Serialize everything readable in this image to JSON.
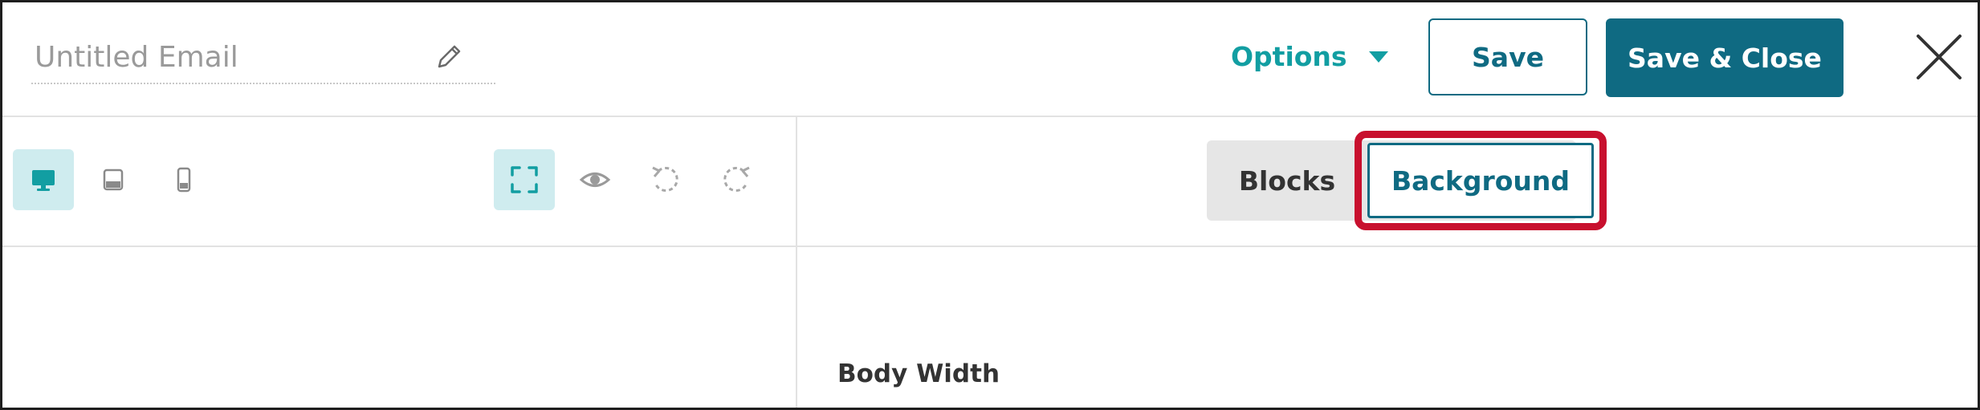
{
  "header": {
    "title": "Untitled Email",
    "edit_icon": "pencil-icon",
    "options_label": "Options",
    "options_icon": "caret-down-icon",
    "save_label": "Save",
    "save_close_label": "Save & Close",
    "close_icon": "close-icon"
  },
  "toolbar": {
    "device_views": [
      {
        "icon": "desktop-icon",
        "active": true
      },
      {
        "icon": "tablet-icon",
        "active": false
      },
      {
        "icon": "mobile-icon",
        "active": false
      }
    ],
    "actions": [
      {
        "icon": "fullscreen-icon",
        "active": true
      },
      {
        "icon": "preview-eye-icon",
        "active": false
      },
      {
        "icon": "undo-icon",
        "active": false
      },
      {
        "icon": "redo-icon",
        "active": false
      }
    ]
  },
  "panel": {
    "tabs": [
      {
        "label": "Blocks",
        "selected": false
      },
      {
        "label": "Background",
        "selected": true
      }
    ],
    "section_label": "Body Width"
  },
  "colors": {
    "accent": "#0f6a82",
    "teal_text": "#129ea2",
    "active_tool_bg": "#cfecef",
    "highlight": "#c8102e"
  }
}
